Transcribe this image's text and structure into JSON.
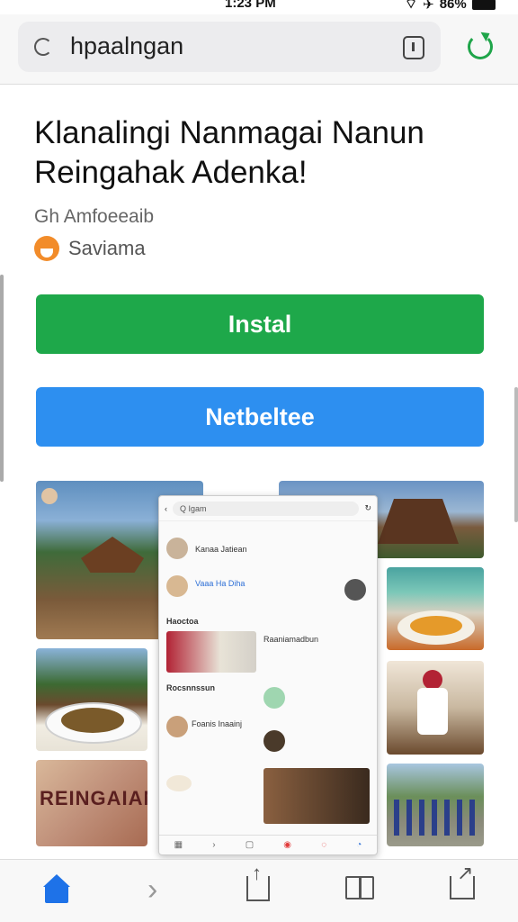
{
  "status_bar": {
    "time": "1:23 PM",
    "battery": "86%"
  },
  "browser": {
    "url": "hpaalngan"
  },
  "app": {
    "title": "Klanalingi Nanmagai Nanun Reingahak Adenka!",
    "developer": "Gh Amfoeeaib",
    "publisher": "Saviama"
  },
  "buttons": {
    "install": "Instal",
    "secondary": "Netbeltee"
  },
  "gallery": {
    "search_placeholder": "Q Igam",
    "feed_title": "Haoctoa",
    "section_label": "Rocsnnssun",
    "item1": "Kanaa Jatiean",
    "item2": "Vaaa Ha Diha",
    "item3": "Raaniamadbun",
    "item4": "Foanis Inaainj",
    "screenshot_caption": "REINGAIANIRI"
  }
}
